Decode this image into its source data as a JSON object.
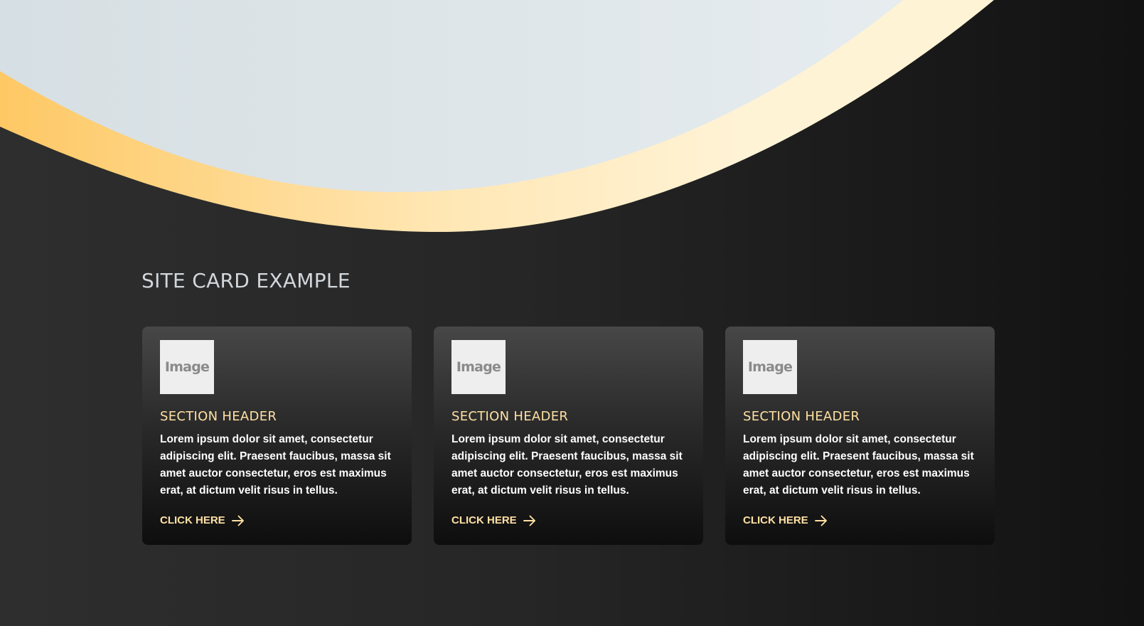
{
  "page": {
    "title": "SITE CARD EXAMPLE"
  },
  "colors": {
    "accent": "#ffe0a3",
    "hero_light": "#dde4e8",
    "hero_band_start": "#fec864",
    "hero_band_end": "#fff3d6",
    "card_image_bg": "#eeeeee"
  },
  "cards": [
    {
      "image_label": "Image",
      "header": "SECTION HEADER",
      "body": "Lorem ipsum dolor sit amet, consectetur adipiscing elit. Praesent faucibus, massa sit amet auctor consectetur, eros est maximus erat, at dictum velit risus in tellus.",
      "link_label": "CLICK HERE",
      "link_icon": "arrow-right-icon"
    },
    {
      "image_label": "Image",
      "header": "SECTION HEADER",
      "body": "Lorem ipsum dolor sit amet, consectetur adipiscing elit. Praesent faucibus, massa sit amet auctor consectetur, eros est maximus erat, at dictum velit risus in tellus.",
      "link_label": "CLICK HERE",
      "link_icon": "arrow-right-icon"
    },
    {
      "image_label": "Image",
      "header": "SECTION HEADER",
      "body": "Lorem ipsum dolor sit amet, consectetur adipiscing elit. Praesent faucibus, massa sit amet auctor consectetur, eros est maximus erat, at dictum velit risus in tellus.",
      "link_label": "CLICK HERE",
      "link_icon": "arrow-right-icon"
    }
  ]
}
